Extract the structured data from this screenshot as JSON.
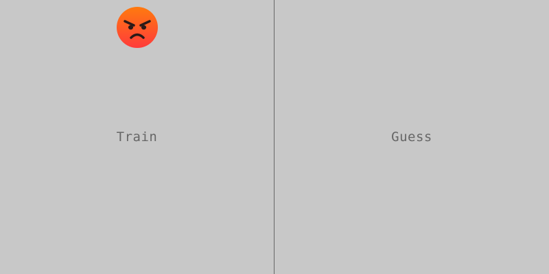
{
  "panes": {
    "train_label": "Train",
    "guess_label": "Guess"
  },
  "emoji": {
    "icon": "angry-face-icon",
    "gradient_top": "#ff7a0f",
    "gradient_bottom": "#ff3b3b"
  },
  "colors": {
    "background": "#c8c8c8",
    "label_text": "#666666",
    "divider": "#666666"
  }
}
